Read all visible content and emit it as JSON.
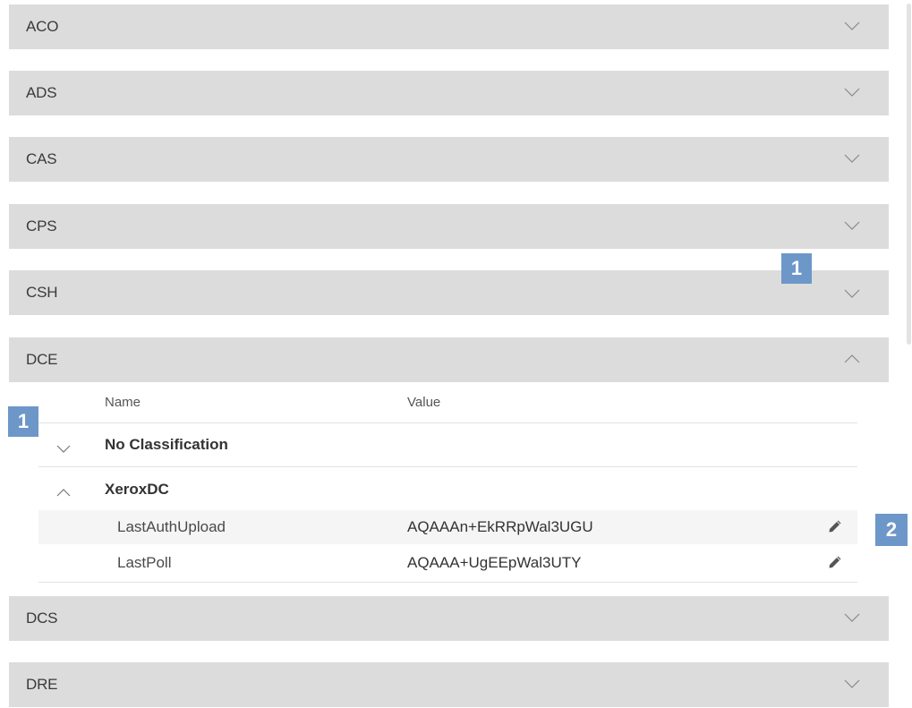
{
  "panels_top": [
    {
      "label": "ACO",
      "state": "collapsed"
    },
    {
      "label": "ADS",
      "state": "collapsed"
    },
    {
      "label": "CAS",
      "state": "collapsed"
    },
    {
      "label": "CPS",
      "state": "collapsed"
    },
    {
      "label": "CSH",
      "state": "collapsed"
    },
    {
      "label": "DCE",
      "state": "expanded"
    }
  ],
  "panels_bottom": [
    {
      "label": "DCS",
      "state": "collapsed"
    },
    {
      "label": "DRE",
      "state": "collapsed"
    }
  ],
  "table": {
    "headers": {
      "name": "Name",
      "value": "Value"
    },
    "groups": [
      {
        "label": "No Classification",
        "state": "collapsed"
      },
      {
        "label": "XeroxDC",
        "state": "expanded"
      }
    ],
    "rows": [
      {
        "name": "LastAuthUpload",
        "value": "AQAAAn+EkRRpWal3UGU",
        "action_icon": "pencil-icon"
      },
      {
        "name": "LastPoll",
        "value": "AQAAA+UgEEpWal3UTY",
        "action_icon": "pencil-icon"
      }
    ]
  },
  "callouts": [
    "1",
    "1",
    "2"
  ],
  "colors": {
    "panel_bg": "#dcdcdc",
    "badge_bg": "#6d97c8",
    "row_highlight": "#f5f5f5"
  }
}
